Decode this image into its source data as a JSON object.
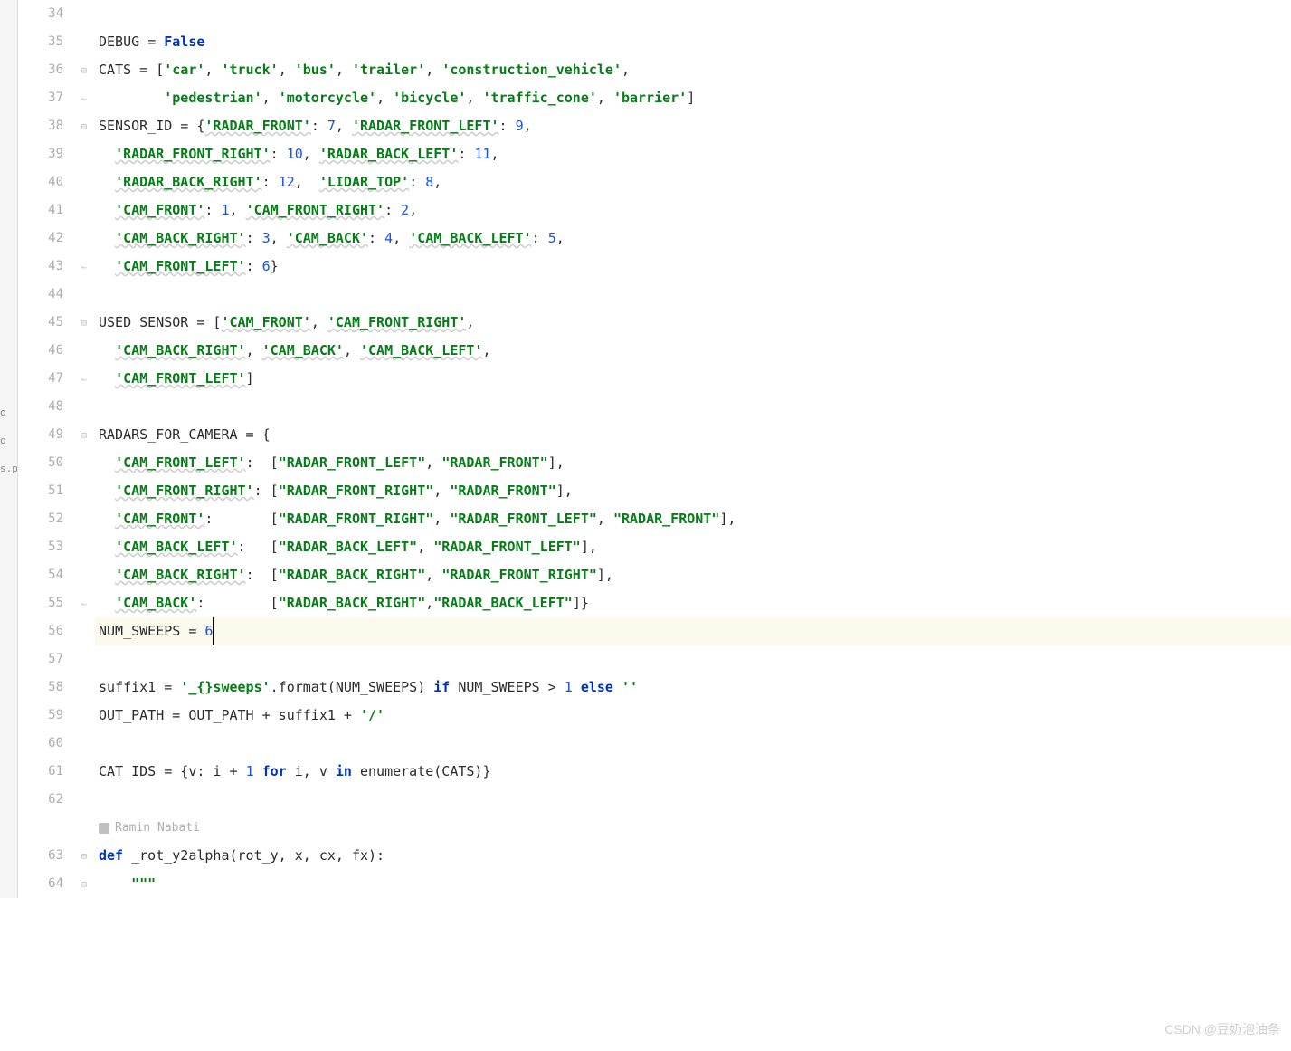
{
  "gutter": {
    "start": 34,
    "end": 64
  },
  "sidebar_hint": [
    "o",
    "o",
    "s.p"
  ],
  "code_lines": [
    {
      "n": 34,
      "fold": "",
      "seg": []
    },
    {
      "n": 35,
      "fold": "",
      "seg": [
        {
          "t": "txt",
          "v": "DEBUG "
        },
        {
          "t": "op",
          "v": "= "
        },
        {
          "t": "kw",
          "v": "False"
        }
      ]
    },
    {
      "n": 36,
      "fold": "⊟",
      "seg": [
        {
          "t": "txt",
          "v": "CATS = ["
        },
        {
          "t": "str",
          "v": "'car'"
        },
        {
          "t": "txt",
          "v": ", "
        },
        {
          "t": "str",
          "v": "'truck'"
        },
        {
          "t": "txt",
          "v": ", "
        },
        {
          "t": "str",
          "v": "'bus'"
        },
        {
          "t": "txt",
          "v": ", "
        },
        {
          "t": "str",
          "v": "'trailer'"
        },
        {
          "t": "txt",
          "v": ", "
        },
        {
          "t": "str",
          "v": "'construction_vehicle'"
        },
        {
          "t": "txt",
          "v": ","
        }
      ]
    },
    {
      "n": 37,
      "fold": "⌊",
      "seg": [
        {
          "t": "txt",
          "v": "        "
        },
        {
          "t": "str",
          "v": "'pedestrian'"
        },
        {
          "t": "txt",
          "v": ", "
        },
        {
          "t": "str",
          "v": "'motorcycle'"
        },
        {
          "t": "txt",
          "v": ", "
        },
        {
          "t": "str",
          "v": "'bicycle'"
        },
        {
          "t": "txt",
          "v": ", "
        },
        {
          "t": "str",
          "v": "'traffic_cone'"
        },
        {
          "t": "txt",
          "v": ", "
        },
        {
          "t": "str",
          "v": "'barrier'"
        },
        {
          "t": "txt",
          "v": "]"
        }
      ]
    },
    {
      "n": 38,
      "fold": "⊟",
      "seg": [
        {
          "t": "txt",
          "v": "SENSOR_ID = {"
        },
        {
          "t": "str-wavy",
          "v": "'RADAR_FRONT'"
        },
        {
          "t": "txt",
          "v": ": "
        },
        {
          "t": "num",
          "v": "7"
        },
        {
          "t": "txt",
          "v": ", "
        },
        {
          "t": "str-wavy",
          "v": "'RADAR_FRONT_LEFT'"
        },
        {
          "t": "txt",
          "v": ": "
        },
        {
          "t": "num",
          "v": "9"
        },
        {
          "t": "txt",
          "v": ","
        }
      ]
    },
    {
      "n": 39,
      "fold": "",
      "seg": [
        {
          "t": "txt",
          "v": "  "
        },
        {
          "t": "str-wavy",
          "v": "'RADAR_FRONT_RIGHT'"
        },
        {
          "t": "txt",
          "v": ": "
        },
        {
          "t": "num",
          "v": "10"
        },
        {
          "t": "txt",
          "v": ", "
        },
        {
          "t": "str-wavy",
          "v": "'RADAR_BACK_LEFT'"
        },
        {
          "t": "txt",
          "v": ": "
        },
        {
          "t": "num",
          "v": "11"
        },
        {
          "t": "txt",
          "v": ","
        }
      ]
    },
    {
      "n": 40,
      "fold": "",
      "seg": [
        {
          "t": "txt",
          "v": "  "
        },
        {
          "t": "str-wavy",
          "v": "'RADAR_BACK_RIGHT'"
        },
        {
          "t": "txt",
          "v": ": "
        },
        {
          "t": "num",
          "v": "12"
        },
        {
          "t": "txt",
          "v": ",  "
        },
        {
          "t": "str-wavy",
          "v": "'LIDAR_TOP'"
        },
        {
          "t": "txt",
          "v": ": "
        },
        {
          "t": "num",
          "v": "8"
        },
        {
          "t": "txt",
          "v": ","
        }
      ]
    },
    {
      "n": 41,
      "fold": "",
      "seg": [
        {
          "t": "txt",
          "v": "  "
        },
        {
          "t": "str-wavy",
          "v": "'CAM_FRONT'"
        },
        {
          "t": "txt",
          "v": ": "
        },
        {
          "t": "num",
          "v": "1"
        },
        {
          "t": "txt",
          "v": ", "
        },
        {
          "t": "str-wavy",
          "v": "'CAM_FRONT_RIGHT'"
        },
        {
          "t": "txt",
          "v": ": "
        },
        {
          "t": "num",
          "v": "2"
        },
        {
          "t": "txt",
          "v": ","
        }
      ]
    },
    {
      "n": 42,
      "fold": "",
      "seg": [
        {
          "t": "txt",
          "v": "  "
        },
        {
          "t": "str-wavy",
          "v": "'CAM_BACK_RIGHT'"
        },
        {
          "t": "txt",
          "v": ": "
        },
        {
          "t": "num",
          "v": "3"
        },
        {
          "t": "txt",
          "v": ", "
        },
        {
          "t": "str-wavy",
          "v": "'CAM_BACK'"
        },
        {
          "t": "txt",
          "v": ": "
        },
        {
          "t": "num",
          "v": "4"
        },
        {
          "t": "txt",
          "v": ", "
        },
        {
          "t": "str-wavy",
          "v": "'CAM_BACK_LEFT'"
        },
        {
          "t": "txt",
          "v": ": "
        },
        {
          "t": "num",
          "v": "5"
        },
        {
          "t": "txt",
          "v": ","
        }
      ]
    },
    {
      "n": 43,
      "fold": "⌊",
      "seg": [
        {
          "t": "txt",
          "v": "  "
        },
        {
          "t": "str-wavy",
          "v": "'CAM_FRONT_LEFT'"
        },
        {
          "t": "txt",
          "v": ": "
        },
        {
          "t": "num",
          "v": "6"
        },
        {
          "t": "txt",
          "v": "}"
        }
      ]
    },
    {
      "n": 44,
      "fold": "",
      "seg": []
    },
    {
      "n": 45,
      "fold": "⊟",
      "seg": [
        {
          "t": "txt",
          "v": "USED_SENSOR = ["
        },
        {
          "t": "str-wavy",
          "v": "'CAM_FRONT'"
        },
        {
          "t": "txt",
          "v": ", "
        },
        {
          "t": "str-wavy",
          "v": "'CAM_FRONT_RIGHT'"
        },
        {
          "t": "txt",
          "v": ","
        }
      ]
    },
    {
      "n": 46,
      "fold": "",
      "seg": [
        {
          "t": "txt",
          "v": "  "
        },
        {
          "t": "str-wavy",
          "v": "'CAM_BACK_RIGHT'"
        },
        {
          "t": "txt",
          "v": ", "
        },
        {
          "t": "str-wavy",
          "v": "'CAM_BACK'"
        },
        {
          "t": "txt",
          "v": ", "
        },
        {
          "t": "str-wavy",
          "v": "'CAM_BACK_LEFT'"
        },
        {
          "t": "txt",
          "v": ","
        }
      ]
    },
    {
      "n": 47,
      "fold": "⌊",
      "seg": [
        {
          "t": "txt",
          "v": "  "
        },
        {
          "t": "str-wavy",
          "v": "'CAM_FRONT_LEFT'"
        },
        {
          "t": "txt",
          "v": "]"
        }
      ]
    },
    {
      "n": 48,
      "fold": "",
      "seg": []
    },
    {
      "n": 49,
      "fold": "⊟",
      "seg": [
        {
          "t": "txt",
          "v": "RADARS_FOR_CAMERA = {"
        }
      ]
    },
    {
      "n": 50,
      "fold": "",
      "seg": [
        {
          "t": "txt",
          "v": "  "
        },
        {
          "t": "str-wavy",
          "v": "'CAM_FRONT_LEFT'"
        },
        {
          "t": "txt",
          "v": ":  ["
        },
        {
          "t": "str",
          "v": "\"RADAR_FRONT_LEFT\""
        },
        {
          "t": "txt",
          "v": ", "
        },
        {
          "t": "str",
          "v": "\"RADAR_FRONT\""
        },
        {
          "t": "txt",
          "v": "],"
        }
      ]
    },
    {
      "n": 51,
      "fold": "",
      "seg": [
        {
          "t": "txt",
          "v": "  "
        },
        {
          "t": "str-wavy",
          "v": "'CAM_FRONT_RIGHT'"
        },
        {
          "t": "txt",
          "v": ": ["
        },
        {
          "t": "str",
          "v": "\"RADAR_FRONT_RIGHT\""
        },
        {
          "t": "txt",
          "v": ", "
        },
        {
          "t": "str",
          "v": "\"RADAR_FRONT\""
        },
        {
          "t": "txt",
          "v": "],"
        }
      ]
    },
    {
      "n": 52,
      "fold": "",
      "seg": [
        {
          "t": "txt",
          "v": "  "
        },
        {
          "t": "str-wavy",
          "v": "'CAM_FRONT'"
        },
        {
          "t": "txt",
          "v": ":       ["
        },
        {
          "t": "str",
          "v": "\"RADAR_FRONT_RIGHT\""
        },
        {
          "t": "txt",
          "v": ", "
        },
        {
          "t": "str",
          "v": "\"RADAR_FRONT_LEFT\""
        },
        {
          "t": "txt",
          "v": ", "
        },
        {
          "t": "str",
          "v": "\"RADAR_FRONT\""
        },
        {
          "t": "txt",
          "v": "],"
        }
      ]
    },
    {
      "n": 53,
      "fold": "",
      "seg": [
        {
          "t": "txt",
          "v": "  "
        },
        {
          "t": "str-wavy",
          "v": "'CAM_BACK_LEFT'"
        },
        {
          "t": "txt",
          "v": ":   ["
        },
        {
          "t": "str",
          "v": "\"RADAR_BACK_LEFT\""
        },
        {
          "t": "txt",
          "v": ", "
        },
        {
          "t": "str",
          "v": "\"RADAR_FRONT_LEFT\""
        },
        {
          "t": "txt",
          "v": "],"
        }
      ]
    },
    {
      "n": 54,
      "fold": "",
      "seg": [
        {
          "t": "txt",
          "v": "  "
        },
        {
          "t": "str-wavy",
          "v": "'CAM_BACK_RIGHT'"
        },
        {
          "t": "txt",
          "v": ":  ["
        },
        {
          "t": "str",
          "v": "\"RADAR_BACK_RIGHT\""
        },
        {
          "t": "txt",
          "v": ", "
        },
        {
          "t": "str",
          "v": "\"RADAR_FRONT_RIGHT\""
        },
        {
          "t": "txt",
          "v": "],"
        }
      ]
    },
    {
      "n": 55,
      "fold": "⌊",
      "seg": [
        {
          "t": "txt",
          "v": "  "
        },
        {
          "t": "str-wavy",
          "v": "'CAM_BACK'"
        },
        {
          "t": "txt",
          "v": ":        ["
        },
        {
          "t": "str",
          "v": "\"RADAR_BACK_RIGHT\""
        },
        {
          "t": "txt",
          "v": ","
        },
        {
          "t": "str",
          "v": "\"RADAR_BACK_LEFT\""
        },
        {
          "t": "txt",
          "v": "]}"
        }
      ]
    },
    {
      "n": 56,
      "fold": "",
      "hl": true,
      "seg": [
        {
          "t": "txt",
          "v": "NUM_SWEEPS = "
        },
        {
          "t": "num",
          "v": "6",
          "cursor": true
        }
      ]
    },
    {
      "n": 57,
      "fold": "",
      "seg": []
    },
    {
      "n": 58,
      "fold": "",
      "seg": [
        {
          "t": "txt",
          "v": "suffix1 = "
        },
        {
          "t": "str",
          "v": "'_{}sweeps'"
        },
        {
          "t": "txt",
          "v": ".format(NUM_SWEEPS) "
        },
        {
          "t": "kw",
          "v": "if"
        },
        {
          "t": "txt",
          "v": " NUM_SWEEPS > "
        },
        {
          "t": "num",
          "v": "1"
        },
        {
          "t": "txt",
          "v": " "
        },
        {
          "t": "kw",
          "v": "else"
        },
        {
          "t": "txt",
          "v": " "
        },
        {
          "t": "str",
          "v": "''"
        }
      ]
    },
    {
      "n": 59,
      "fold": "",
      "seg": [
        {
          "t": "txt",
          "v": "OUT_PATH = OUT_PATH + suffix1 + "
        },
        {
          "t": "str",
          "v": "'/'"
        }
      ]
    },
    {
      "n": 60,
      "fold": "",
      "seg": []
    },
    {
      "n": 61,
      "fold": "",
      "seg": [
        {
          "t": "txt",
          "v": "CAT_IDS = {v: i + "
        },
        {
          "t": "num",
          "v": "1"
        },
        {
          "t": "txt",
          "v": " "
        },
        {
          "t": "kw",
          "v": "for"
        },
        {
          "t": "txt",
          "v": " i, v "
        },
        {
          "t": "kw",
          "v": "in"
        },
        {
          "t": "txt",
          "v": " "
        },
        {
          "t": "bi",
          "v": "enumerate"
        },
        {
          "t": "txt",
          "v": "(CATS)}"
        }
      ]
    },
    {
      "n": 62,
      "fold": "",
      "seg": []
    },
    {
      "n": "author",
      "fold": "",
      "author": "Ramin Nabati"
    },
    {
      "n": 63,
      "fold": "⊟",
      "seg": [
        {
          "t": "kw",
          "v": "def"
        },
        {
          "t": "txt",
          "v": " "
        },
        {
          "t": "fn",
          "v": "_rot_y2alpha"
        },
        {
          "t": "txt",
          "v": "(rot_y, x, cx, fx):"
        }
      ]
    },
    {
      "n": 64,
      "fold": "⊟",
      "seg": [
        {
          "t": "txt",
          "v": "    "
        },
        {
          "t": "str",
          "v": "\"\"\""
        }
      ]
    }
  ],
  "watermark": "CSDN @豆奶泡油条"
}
